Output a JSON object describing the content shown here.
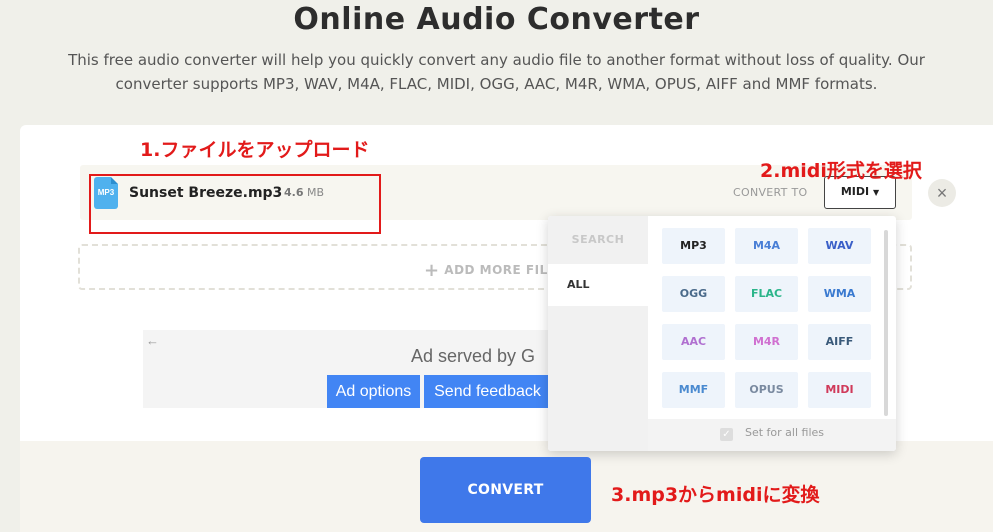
{
  "header": {
    "title": "Online Audio Converter",
    "subtitle": "This free audio converter will help you quickly convert any audio file to another format without loss of quality. Our converter supports MP3, WAV, M4A, FLAC, MIDI, OGG, AAC, M4R, WMA, OPUS, AIFF and MMF formats."
  },
  "file": {
    "icon_label": "MP3",
    "name": "Sunset Breeze.mp3",
    "size_value": "4.6",
    "size_unit": "MB",
    "convert_to_label": "CONVERT TO",
    "selected_format": "MIDI",
    "close_glyph": "×"
  },
  "add_more": {
    "label": "ADD MORE FIL"
  },
  "ad": {
    "back_glyph": "←",
    "served_text": "Ad served by G",
    "options_label": "Ad options",
    "feedback_label": "Send feedback"
  },
  "dropdown": {
    "search_label": "SEARCH",
    "category_all": "ALL",
    "formats": [
      {
        "label": "MP3",
        "color": "#222222"
      },
      {
        "label": "M4A",
        "color": "#4a7fd6"
      },
      {
        "label": "WAV",
        "color": "#3a5fc8"
      },
      {
        "label": "OGG",
        "color": "#4a6a8a"
      },
      {
        "label": "FLAC",
        "color": "#2bb58a"
      },
      {
        "label": "WMA",
        "color": "#3a7ad0"
      },
      {
        "label": "AAC",
        "color": "#b070d0"
      },
      {
        "label": "M4R",
        "color": "#d070d0"
      },
      {
        "label": "AIFF",
        "color": "#3a5a7a"
      },
      {
        "label": "MMF",
        "color": "#4a8ad0"
      },
      {
        "label": "OPUS",
        "color": "#7a8aa0"
      },
      {
        "label": "MIDI",
        "color": "#d03a5a"
      }
    ],
    "set_all_label": "Set for all files"
  },
  "convert_label": "CONVERT",
  "annotations": {
    "step1": "1.ファイルをアップロード",
    "step2": "2.midi形式を選択",
    "step3": "3.mp3からmidiに変換"
  },
  "colors": {
    "annotation": "#e21a1a",
    "convert_button": "#3f78ea",
    "ad_button": "#4285f4"
  }
}
